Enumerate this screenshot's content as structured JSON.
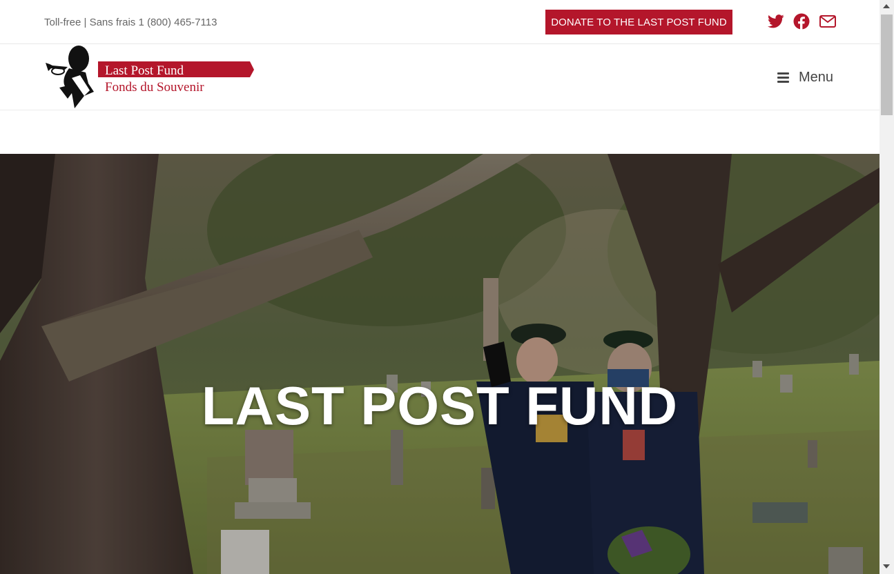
{
  "topbar": {
    "tollfree": "Toll-free | Sans frais 1 (800) 465-7113",
    "donate_label": "DONATE TO THE LAST POST FUND",
    "social": [
      {
        "icon": "twitter-icon"
      },
      {
        "icon": "facebook-icon"
      },
      {
        "icon": "mail-icon"
      }
    ]
  },
  "header": {
    "logo": {
      "line1": "Last Post Fund",
      "line2": "Fonds du Souvenir"
    },
    "menu_label": "Menu"
  },
  "hero": {
    "title": "LAST POST FUND"
  },
  "colors": {
    "brand_red": "#b4162b",
    "text_gray": "#666666",
    "menu_gray": "#444444"
  }
}
